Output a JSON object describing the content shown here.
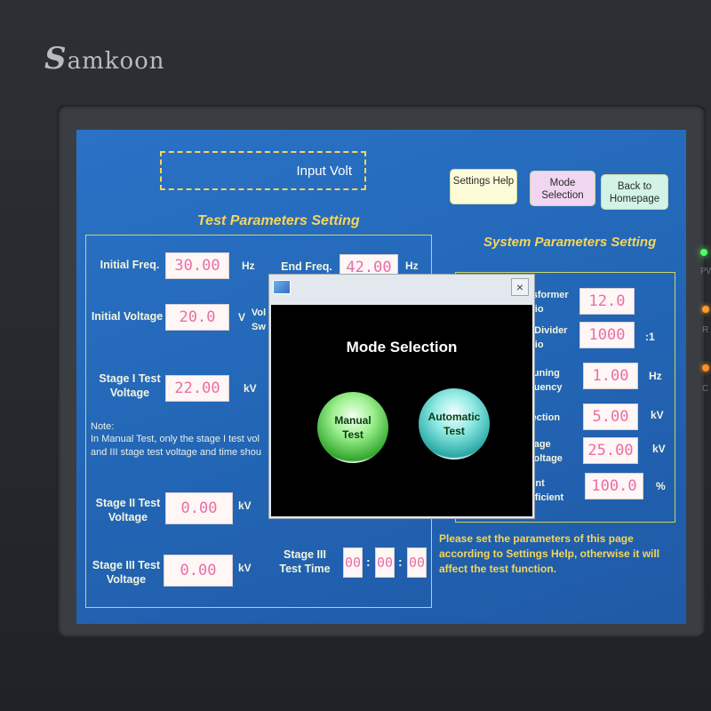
{
  "device": {
    "brand_initial": "S",
    "brand_rest": "amkoon",
    "leds": [
      "PW",
      "R",
      "C"
    ]
  },
  "screen": {
    "input_volt_label": "Input Volt",
    "buttons": {
      "settings_help": "Settings Help",
      "mode_selection": "Mode Selection",
      "back_to_homepage": "Back to Homepage"
    },
    "test_parameters": {
      "title": "Test Parameters Setting",
      "initial_freq": {
        "label": "Initial Freq.",
        "value": "30.00",
        "unit": "Hz"
      },
      "end_freq": {
        "label": "End Freq.",
        "value": "42.00",
        "unit": "Hz"
      },
      "initial_voltage": {
        "label": "Initial Voltage",
        "value": "20.0",
        "unit": "V"
      },
      "voltage_sw_label": "Vol Sw",
      "stage1_voltage": {
        "label": "Stage I Test Voltage",
        "value": "22.00",
        "unit": "kV"
      },
      "note_title": "Note:",
      "note_line1": "In Manual Test, only the stage I test vol",
      "note_line2": "and III stage test voltage and time shou",
      "stage2_voltage": {
        "label": "Stage II Test Voltage",
        "value": "0.00",
        "unit": "kV"
      },
      "stage3_voltage": {
        "label": "Stage III Test Voltage",
        "value": "0.00",
        "unit": "kV"
      },
      "stage3_time": {
        "label": "Stage III Test Time",
        "hh": "00",
        "mm": "00",
        "ss": "00",
        "sep": ":"
      }
    },
    "system_parameters": {
      "title": "System Parameters Setting",
      "transformer_ratio": {
        "label": "nsformer atio",
        "value": "12.0"
      },
      "divider_ratio": {
        "label": "e Divider atio",
        "value": "1000",
        "unit": ":1"
      },
      "tuning_frequency": {
        "label": "Tuning quency",
        "value": "1.00",
        "unit": "Hz"
      },
      "protection": {
        "label": "tection",
        "value": "5.00",
        "unit": "kV"
      },
      "voltage": {
        "label": "ltage Voltage",
        "value": "25.00",
        "unit": "kV"
      },
      "current_coefficient": {
        "label": "rent efficient",
        "value": "100.0",
        "unit": "%"
      },
      "notice": "Please set the parameters of this page according to Settings Help, otherwise it will affect the test function."
    },
    "dialog": {
      "title": "Mode Selection",
      "close": "×",
      "manual_line1": "Manual",
      "manual_line2": "Test",
      "automatic_line1": "Automatic",
      "automatic_line2": "Test"
    }
  }
}
